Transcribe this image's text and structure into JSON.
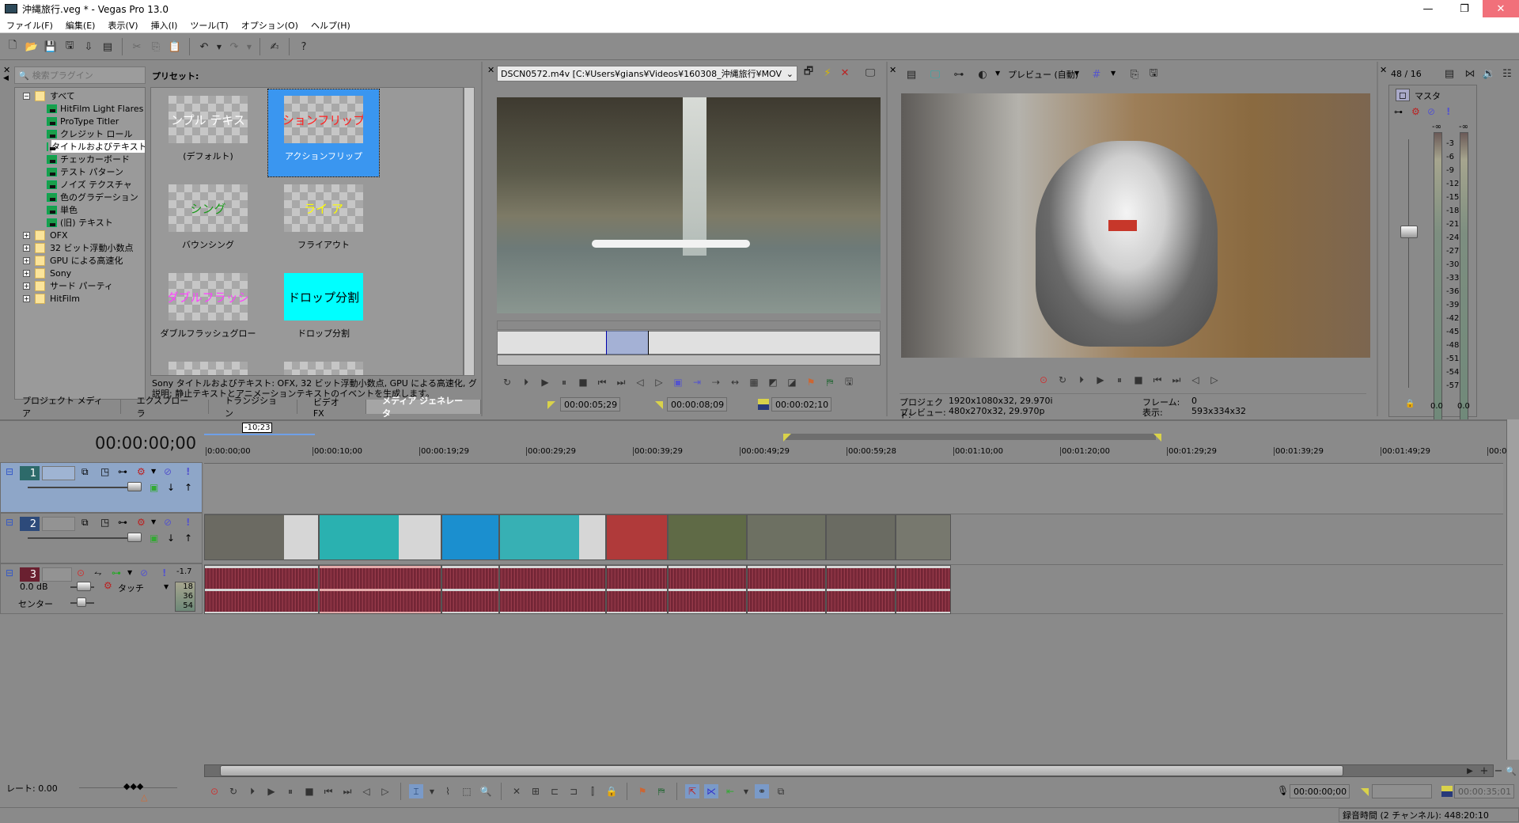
{
  "window": {
    "title": "沖縄旅行.veg * - Vegas Pro 13.0",
    "controls": [
      "minimize",
      "maximize",
      "close"
    ]
  },
  "menu": [
    "ファイル(F)",
    "編集(E)",
    "表示(V)",
    "挿入(I)",
    "ツール(T)",
    "オプション(O)",
    "ヘルプ(H)"
  ],
  "toolbar": {
    "icons": [
      "new-icon",
      "open-icon",
      "save-icon",
      "save-as-icon",
      "render-icon",
      "properties-icon",
      "cut-icon",
      "copy-icon",
      "paste-icon",
      "undo-icon",
      "redo-icon",
      "edit-tool-icon",
      "whats-this-icon"
    ]
  },
  "media_generators": {
    "search_placeholder": "検索プラグイン",
    "tree": [
      {
        "label": "すべて",
        "type": "folder",
        "expanded": true,
        "level": 0
      },
      {
        "label": "HitFilm Light Flares",
        "type": "plugin",
        "level": 1
      },
      {
        "label": "ProType Titler",
        "type": "plugin",
        "level": 1
      },
      {
        "label": "クレジット ロール",
        "type": "plugin",
        "level": 1
      },
      {
        "label": "タイトルおよびテキスト",
        "type": "plugin",
        "level": 1,
        "selected": true
      },
      {
        "label": "チェッカーボード",
        "type": "plugin",
        "level": 1
      },
      {
        "label": "テスト パターン",
        "type": "plugin",
        "level": 1
      },
      {
        "label": "ノイズ テクスチャ",
        "type": "plugin",
        "level": 1
      },
      {
        "label": "色のグラデーション",
        "type": "plugin",
        "level": 1
      },
      {
        "label": "単色",
        "type": "plugin",
        "level": 1
      },
      {
        "label": "(旧) テキスト",
        "type": "plugin",
        "level": 1
      },
      {
        "label": "OFX",
        "type": "folder",
        "expanded": false,
        "level": 0
      },
      {
        "label": "32 ビット浮動小数点",
        "type": "folder",
        "expanded": false,
        "level": 0
      },
      {
        "label": "GPU による高速化",
        "type": "folder",
        "expanded": false,
        "level": 0
      },
      {
        "label": "Sony",
        "type": "folder",
        "expanded": false,
        "level": 0
      },
      {
        "label": "サード パーティ",
        "type": "folder",
        "expanded": false,
        "level": 0
      },
      {
        "label": "HitFilm",
        "type": "folder",
        "expanded": false,
        "level": 0
      }
    ],
    "presets_label": "プリセット:",
    "presets": [
      {
        "label": "(デフォルト)",
        "thumb_text": "ンプル テキス",
        "thumb_color": "#ffffff",
        "selected": false
      },
      {
        "label": "アクションフリップ",
        "thumb_text": "ションフリップ",
        "thumb_color": "#ff2020",
        "selected": true
      },
      {
        "label": "バウンシング",
        "thumb_text": "シング",
        "thumb_color": "#1a9a1a",
        "selected": false
      },
      {
        "label": "フライアウト",
        "thumb_text": "ライ ア",
        "thumb_color": "#ffff00",
        "selected": false
      },
      {
        "label": "ダブルフラッシュグロー",
        "thumb_text": "ダブルフラッシ",
        "thumb_color": "#ff40ff",
        "selected": false
      },
      {
        "label": "ドロップ分割",
        "thumb_text": "ドロップ分割",
        "thumb_color": "#000000",
        "selected": false
      }
    ],
    "description_line1": "Sony タイトルおよびテキスト: OFX, 32 ビット浮動小数点, GPU による高速化, グルー",
    "description_line2": "説明: 静止テキストとアニメーションテキストのイベントを生成します。",
    "tabs": [
      {
        "label": "プロジェクト メディア",
        "active": false
      },
      {
        "label": "エクスプローラ",
        "active": false
      },
      {
        "label": "トランジション",
        "active": false
      },
      {
        "label": "ビデオ FX",
        "active": false
      },
      {
        "label": "メディア ジェネレータ",
        "active": true
      }
    ]
  },
  "trimmer": {
    "file": "DSCN0572.m4v    [C:¥Users¥gians¥Videos¥160308_沖縄旅行¥MOV",
    "in_time": "00:00:05;29",
    "out_time": "00:00:08;09",
    "length": "00:00:02;10"
  },
  "preview": {
    "quality": "プレビュー (自動)",
    "project_label": "プロジェクト:",
    "project_value": "1920x1080x32, 29.970i",
    "preview_label": "プレビュー:",
    "preview_value": "480x270x32, 29.970p",
    "frame_label": "フレーム:",
    "frame_value": "0",
    "display_label": "表示:",
    "display_value": "593x334x32"
  },
  "mixer": {
    "ratio": "48 / 16",
    "master_label": "マスタ",
    "peak_left": "-∞",
    "peak_right": "-∞",
    "scale": [
      "3",
      "6",
      "9",
      "12",
      "15",
      "18",
      "21",
      "24",
      "27",
      "30",
      "33",
      "36",
      "39",
      "42",
      "45",
      "48",
      "51",
      "54",
      "57"
    ],
    "level_left": "0.0",
    "level_right": "0.0"
  },
  "timeline": {
    "cursor_time": "00:00:00;00",
    "offset_label": "-10;23",
    "ruler": [
      "0:00:00;00",
      "00:00:10;00",
      "00:00:19;29",
      "00:00:29;29",
      "00:00:39;29",
      "00:00:49;29",
      "00:00:59;28",
      "00:01:10;00",
      "00:01:20;00",
      "00:01:29;29",
      "00:01:39;29",
      "00:01:49;29",
      "00:0"
    ],
    "tracks": [
      {
        "number": "1",
        "type": "video",
        "selected": true
      },
      {
        "number": "2",
        "type": "video",
        "selected": false
      },
      {
        "number": "3",
        "type": "audio",
        "selected": false,
        "volume": "0.0 dB",
        "pan": "センター",
        "automation": "タッチ",
        "peak": "-1.7",
        "meter_scale": [
          "18",
          "36",
          "54"
        ]
      }
    ],
    "rate_label": "レート:",
    "rate_value": "0.00",
    "cursor_pos": "00:00:00;00",
    "selection_start": "",
    "selection_length": "00:00:35;01"
  },
  "status": {
    "record_time": "録音時間 (2 チャンネル): 448:20:10"
  }
}
